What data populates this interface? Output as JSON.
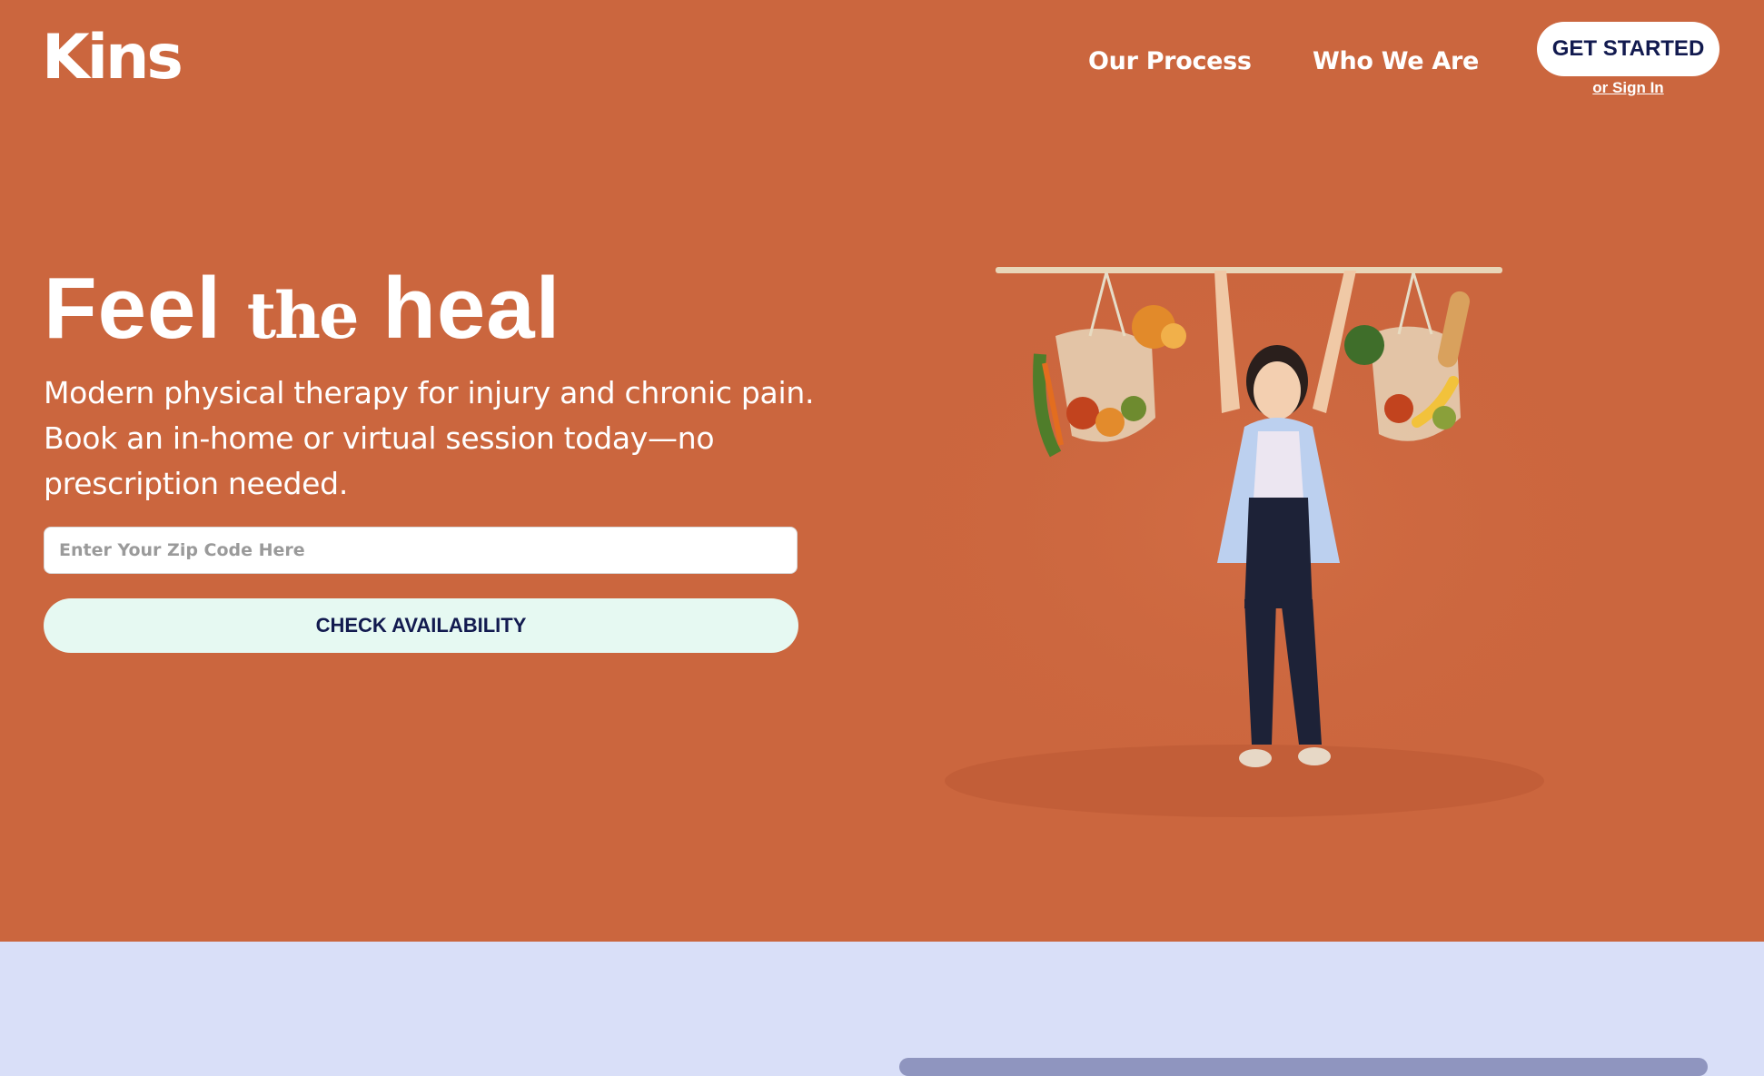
{
  "header": {
    "logo_text": "Kins",
    "nav": [
      {
        "label": "Our Process"
      },
      {
        "label": "Who We Are"
      }
    ],
    "cta_label": "GET STARTED",
    "sign_in_label": "or Sign In"
  },
  "hero": {
    "headline_part1": "Feel ",
    "headline_part2": "the",
    "headline_part3": " heal",
    "subtext": "Modern physical therapy for injury and chronic pain. Book an in-home or virtual session today—no prescription needed.",
    "zip_placeholder": "Enter Your Zip Code Here",
    "check_button_label": "CHECK AVAILABILITY",
    "image_description_icon": "person-lifting-pole-with-grocery-bags"
  },
  "colors": {
    "hero_bg": "#cb663e",
    "lower_bg": "#d9dff8",
    "button_text": "#121a4f",
    "check_button_bg": "#e6f9f2"
  }
}
